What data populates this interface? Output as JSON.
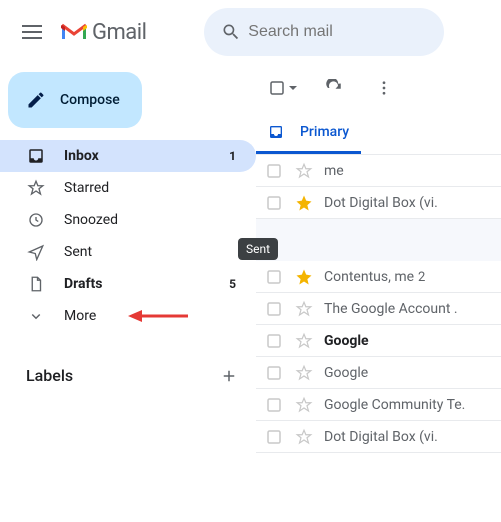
{
  "header": {
    "logo_text": "Gmail",
    "search_placeholder": "Search mail"
  },
  "compose": {
    "label": "Compose"
  },
  "nav": {
    "inbox": {
      "label": "Inbox",
      "count": "1"
    },
    "starred": {
      "label": "Starred"
    },
    "snoozed": {
      "label": "Snoozed"
    },
    "sent": {
      "label": "Sent"
    },
    "drafts": {
      "label": "Drafts",
      "count": "5"
    },
    "more": {
      "label": "More"
    }
  },
  "labels": {
    "title": "Labels"
  },
  "tooltip": {
    "text": "Sent"
  },
  "tab": {
    "primary": "Primary"
  },
  "rows": [
    {
      "sender": "me",
      "starred": false,
      "unread": false
    },
    {
      "sender": "Dot Digital Box (vi.",
      "starred": true,
      "unread": false
    },
    {
      "sender": "Contentus, me",
      "count": "2",
      "starred": true,
      "unread": false
    },
    {
      "sender": "The Google Account .",
      "starred": false,
      "unread": false
    },
    {
      "sender": "Google",
      "starred": false,
      "unread": true
    },
    {
      "sender": "Google",
      "starred": false,
      "unread": false
    },
    {
      "sender": "Google Community Te.",
      "starred": false,
      "unread": false
    },
    {
      "sender": "Dot Digital Box (vi.",
      "starred": false,
      "unread": false
    }
  ],
  "colors": {
    "star_gold": "#f4b400",
    "star_empty": "#c8c8c8",
    "accent": "#0b57d0"
  }
}
